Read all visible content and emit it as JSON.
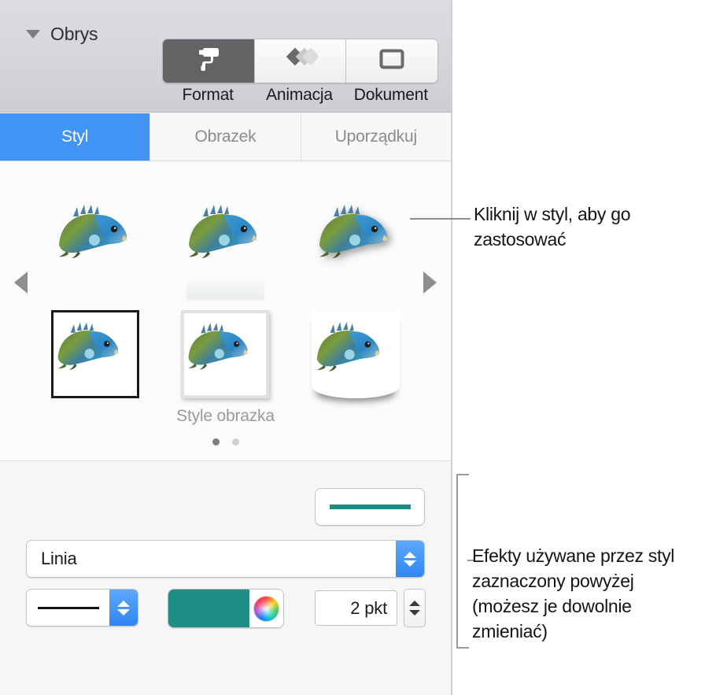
{
  "inspector": {
    "segmented_control": {
      "items": [
        {
          "label": "Format",
          "icon": "paint-roller-icon",
          "selected": true
        },
        {
          "label": "Animacja",
          "icon": "animation-diamonds-icon",
          "selected": false
        },
        {
          "label": "Dokument",
          "icon": "document-rectangle-icon",
          "selected": false
        }
      ]
    },
    "tabs": [
      {
        "label": "Styl",
        "selected": true
      },
      {
        "label": "Obrazek",
        "selected": false
      },
      {
        "label": "Uporządkuj",
        "selected": false
      }
    ],
    "gallery": {
      "label": "Style obrazka",
      "prev_icon": "triangle-left-icon",
      "next_icon": "triangle-right-icon",
      "page_dots": [
        {
          "active": true
        },
        {
          "active": false
        }
      ],
      "thumbnails": [
        {
          "name": "plain",
          "variant": "plain",
          "subject": "iguana-photo"
        },
        {
          "name": "reflection",
          "variant": "reflection",
          "subject": "iguana-photo"
        },
        {
          "name": "drop-shadow",
          "variant": "shadow",
          "subject": "iguana-photo"
        },
        {
          "name": "black-frame",
          "variant": "frame-black",
          "subject": "iguana-photo",
          "selected": true
        },
        {
          "name": "gray-frame",
          "variant": "frame-gray",
          "subject": "iguana-photo"
        },
        {
          "name": "curled-page",
          "variant": "curl",
          "subject": "iguana-photo"
        }
      ]
    },
    "outline": {
      "disclosure_icon": "triangle-down-icon",
      "title": "Obrys",
      "line_preview_color": "#1d8b83",
      "style_select": {
        "value": "Linia"
      },
      "line_style": {
        "sample": "solid-line"
      },
      "color_well": {
        "color": "#1f8d84",
        "wheel_icon": "color-wheel-icon"
      },
      "width": {
        "value": "2 pkt"
      }
    }
  },
  "annotations": {
    "callout_style": "Kliknij w styl, aby go zastosować",
    "callout_effects": "Efekty używane przez styl zaznaczony powyżej (możesz je dowolnie zmieniać)"
  },
  "colors": {
    "accent_blue": "#4294f7",
    "teal": "#1f8d84",
    "header_gray": "#d6d7dc",
    "panel_bg": "#f6f6f6"
  }
}
